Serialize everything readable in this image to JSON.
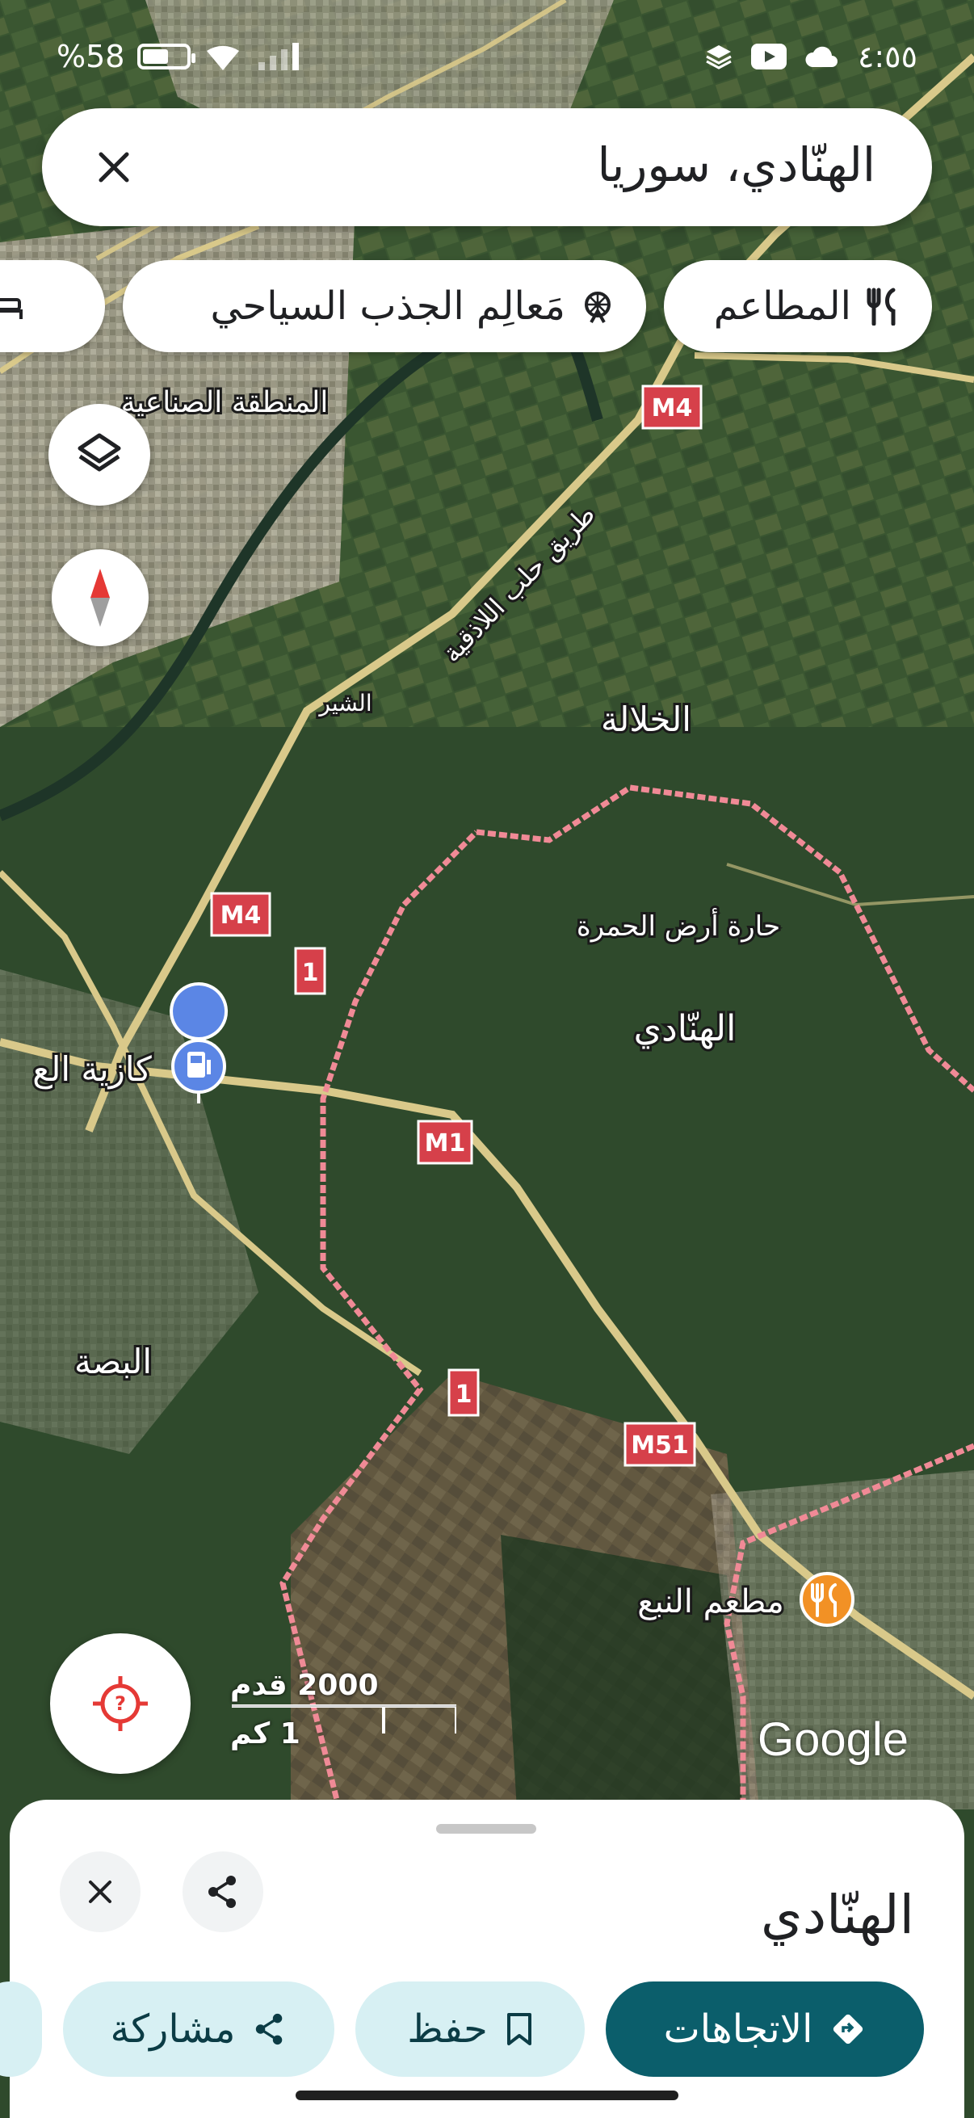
{
  "status_bar": {
    "battery_text": "%58",
    "battery_level": 0.58,
    "time": "٤:٥٥",
    "icons": [
      "battery-icon",
      "wifi-icon",
      "signal-icon",
      "layers-status-icon",
      "youtube-icon",
      "cloud-icon"
    ]
  },
  "search": {
    "query": "الهنّادي، سوريا",
    "close_icon": "close-icon"
  },
  "chips": [
    {
      "label": "المطاعم",
      "icon": "restaurant-icon"
    },
    {
      "label": "مَعالِم الجذب السياحي",
      "icon": "attractions-icon"
    },
    {
      "label": "",
      "icon": "hotel-icon"
    }
  ],
  "map": {
    "place_labels": {
      "industrial_zone": "المنطقة الصناعية",
      "khalala": "الخلالة",
      "shir": "الشير",
      "road_name": "طريق حلب اللاذقية",
      "harat_ard": "حارة أرض الحمرة",
      "hinnadi": "الهنّادي",
      "basseh": "البصة",
      "gas_station": "كازية الع",
      "restaurant": "مطعم النبع"
    },
    "road_shields": {
      "m4_top": "M4",
      "m4_left": "M4",
      "one_a": "1",
      "m1": "M1",
      "one_b": "1",
      "m51": "M51"
    },
    "scale_feet": "2000 قدم",
    "scale_km": "1 كم",
    "attribution": "Google",
    "colors": {
      "terrain": "#2f4a2c",
      "road": "#d9c98a",
      "boundary": "#f08a96",
      "shield": "#d6404a",
      "restaurant_pin": "#f29125",
      "gas_pin": "#5b86e5"
    }
  },
  "controls": {
    "layers_icon": "layers-icon",
    "compass_icon": "compass-icon",
    "location_icon": "my-location-icon"
  },
  "sheet": {
    "title": "الهنّادي",
    "buttons": [
      {
        "label": "الاتجاهات",
        "icon": "directions-icon"
      },
      {
        "label": "حفظ",
        "icon": "bookmark-icon"
      },
      {
        "label": "مشاركة",
        "icon": "share-icon"
      }
    ],
    "close_icon": "close-icon",
    "share_icon": "share-icon"
  },
  "accent_color": "#0b5e6b"
}
